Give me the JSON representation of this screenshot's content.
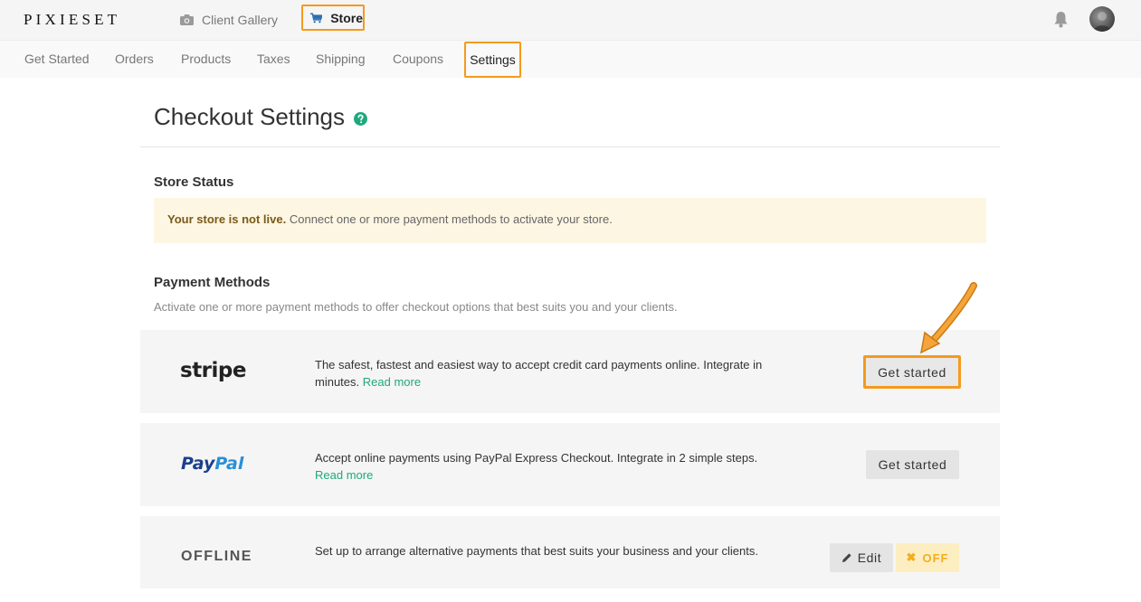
{
  "header": {
    "logo": "PIXIESET",
    "tabs": [
      {
        "label": "Client Gallery",
        "icon": "camera-icon"
      },
      {
        "label": "Store",
        "icon": "cart-icon"
      }
    ]
  },
  "subnav": {
    "items": [
      "Get Started",
      "Orders",
      "Products",
      "Taxes",
      "Shipping",
      "Coupons",
      "Settings"
    ],
    "active": "Settings"
  },
  "page": {
    "title": "Checkout Settings"
  },
  "store_status": {
    "heading": "Store Status",
    "notice_bold": "Your store is not live.",
    "notice_text": " Connect one or more payment methods to activate your store."
  },
  "payment_methods": {
    "heading": "Payment Methods",
    "subtext": "Activate one or more payment methods to offer checkout options that best suits you and your clients.",
    "stripe": {
      "logo": "stripe",
      "description": "The safest, fastest and easiest way to accept credit card payments online. Integrate in minutes.",
      "link": "Read more",
      "button": "Get started"
    },
    "paypal": {
      "logo_part1": "Pay",
      "logo_part2": "Pal",
      "description": "Accept online payments using PayPal Express Checkout. Integrate in 2 simple steps.",
      "link": "Read more",
      "button": "Get started"
    },
    "offline": {
      "logo": "OFFLINE",
      "description": "Set up to arrange alternative payments that best suits your business and your clients.",
      "edit_button": "Edit",
      "toggle_label": "OFF"
    }
  },
  "colors": {
    "highlight": "#f49a1d",
    "link": "#1fa87d",
    "notice_bg": "#fdf6e3",
    "off_toggle": "#f1ae1c"
  }
}
